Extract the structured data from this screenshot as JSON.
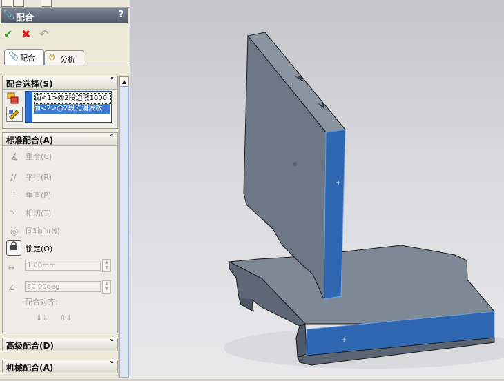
{
  "property_manager": {
    "title": "配合",
    "help_icon": "?",
    "tabs": [
      {
        "label": "配合",
        "icon": "paperclip-icon"
      },
      {
        "label": "分析",
        "icon": "gears-icon"
      }
    ],
    "actions": {
      "ok": "✔",
      "cancel": "✖",
      "undo": "↶"
    }
  },
  "mate_selection": {
    "header": "配合选择(S)",
    "items": [
      "面<1>@2段边墩1000",
      "面<2>@2段光滑底板"
    ]
  },
  "standard_mates": {
    "header": "标准配合(A)",
    "options": [
      {
        "label": "重合(C)",
        "icon": "coincident-icon",
        "enabled": false
      },
      {
        "label": "平行(R)",
        "icon": "parallel-icon",
        "enabled": false
      },
      {
        "label": "垂直(P)",
        "icon": "perpendicular-icon",
        "enabled": false
      },
      {
        "label": "相切(T)",
        "icon": "tangent-icon",
        "enabled": false
      },
      {
        "label": "同轴心(N)",
        "icon": "concentric-icon",
        "enabled": false
      },
      {
        "label": "锁定(O)",
        "icon": "lock-icon",
        "enabled": true
      }
    ],
    "distance_value": "1.00mm",
    "angle_value": "30.00deg",
    "alignment_label": "配合对齐:"
  },
  "advanced_mates": {
    "header": "高级配合(D)"
  },
  "mechanical_mates": {
    "header": "机械配合(A)"
  },
  "colors": {
    "face_highlight": "#2e67b0",
    "part_body": "#6f7a88",
    "header_bar": "#5a6473"
  }
}
